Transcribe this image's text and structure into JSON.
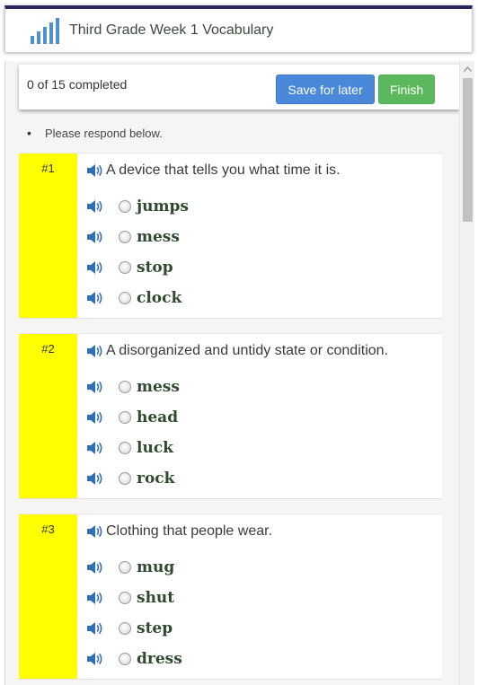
{
  "header": {
    "title": "Third Grade Week 1 Vocabulary",
    "logo_icon": "bar-chart-logo-icon"
  },
  "progress": {
    "text": "0 of 15 completed",
    "save_label": "Save for later",
    "finish_label": "Finish",
    "save_color": "#4a88da",
    "finish_color": "#5cb85c"
  },
  "instructions": {
    "bullet": "•",
    "text": "Please respond below."
  },
  "questions": [
    {
      "number": "#1",
      "prompt": "A device that tells you what time it is.",
      "options": [
        "jumps",
        "mess",
        "stop",
        "clock"
      ]
    },
    {
      "number": "#2",
      "prompt": "A disorganized and untidy state or condition.",
      "options": [
        "mess",
        "head",
        "luck",
        "rock"
      ]
    },
    {
      "number": "#3",
      "prompt": "Clothing that people wear.",
      "options": [
        "mug",
        "shut",
        "step",
        "dress"
      ]
    }
  ],
  "colors": {
    "question_number_bg": "#ffff00",
    "header_border": "#27275e",
    "option_text": "#2f4a2f"
  }
}
